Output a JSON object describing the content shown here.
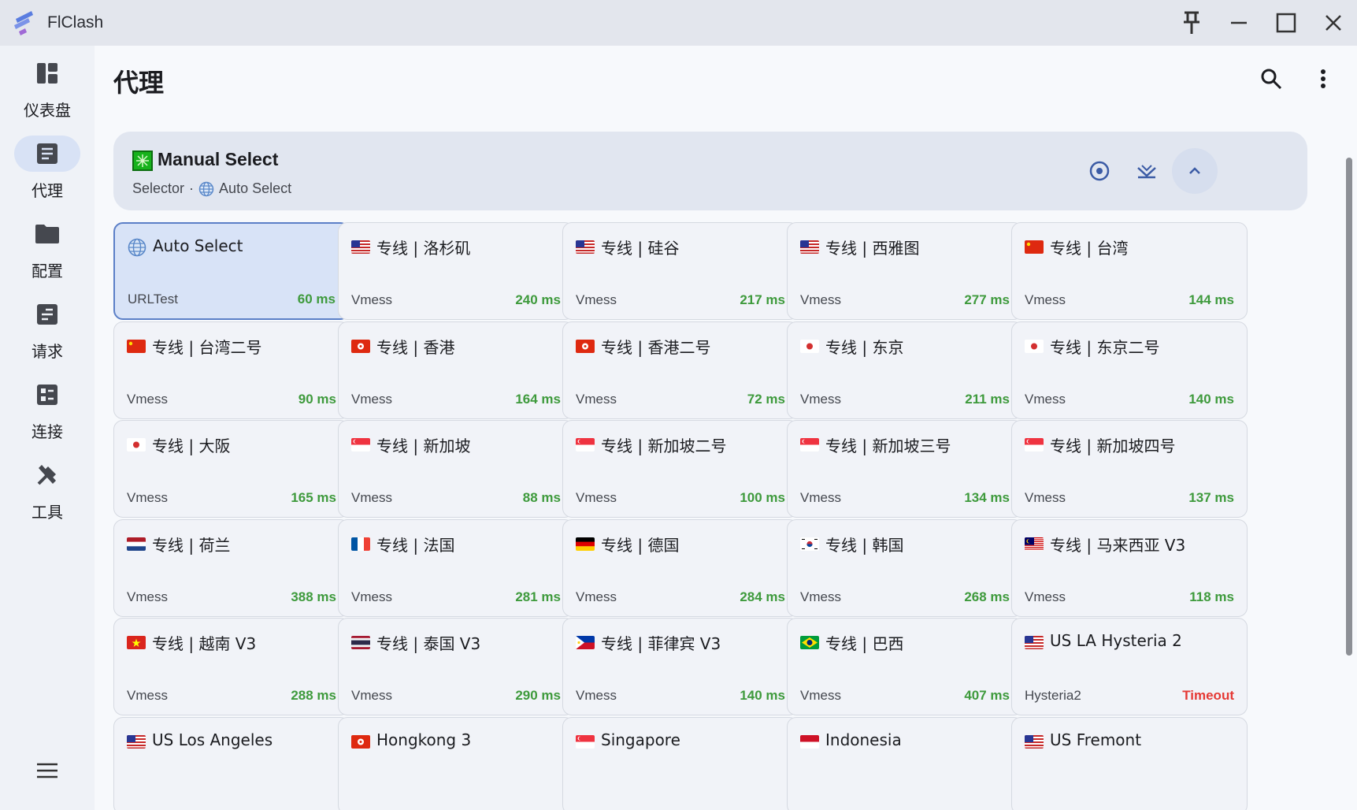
{
  "app": {
    "title": "FlClash"
  },
  "nav": {
    "items": [
      {
        "label": "仪表盘",
        "icon": "dashboard-icon",
        "active": false
      },
      {
        "label": "代理",
        "icon": "proxy-icon",
        "active": true
      },
      {
        "label": "配置",
        "icon": "folder-icon",
        "active": false
      },
      {
        "label": "请求",
        "icon": "requests-icon",
        "active": false
      },
      {
        "label": "连接",
        "icon": "connections-icon",
        "active": false
      },
      {
        "label": "工具",
        "icon": "tools-icon",
        "active": false
      }
    ]
  },
  "page": {
    "title": "代理"
  },
  "group": {
    "name": "Manual Select",
    "type": "Selector",
    "separator": "·",
    "current": "Auto Select"
  },
  "proxies": [
    {
      "name": "Auto Select",
      "type": "URLTest",
      "delay": "60 ms",
      "flag": "globe",
      "selected": true
    },
    {
      "name": "专线 | 洛杉矶",
      "type": "Vmess",
      "delay": "240 ms",
      "flag": "us"
    },
    {
      "name": "专线 | 硅谷",
      "type": "Vmess",
      "delay": "217 ms",
      "flag": "us"
    },
    {
      "name": "专线 | 西雅图",
      "type": "Vmess",
      "delay": "277 ms",
      "flag": "us"
    },
    {
      "name": "专线 | 台湾",
      "type": "Vmess",
      "delay": "144 ms",
      "flag": "cn"
    },
    {
      "name": "专线 | 台湾二号",
      "type": "Vmess",
      "delay": "90 ms",
      "flag": "cn"
    },
    {
      "name": "专线 | 香港",
      "type": "Vmess",
      "delay": "164 ms",
      "flag": "hk"
    },
    {
      "name": "专线 | 香港二号",
      "type": "Vmess",
      "delay": "72 ms",
      "flag": "hk"
    },
    {
      "name": "专线 | 东京",
      "type": "Vmess",
      "delay": "211 ms",
      "flag": "jp"
    },
    {
      "name": "专线 | 东京二号",
      "type": "Vmess",
      "delay": "140 ms",
      "flag": "jp"
    },
    {
      "name": "专线 | 大阪",
      "type": "Vmess",
      "delay": "165 ms",
      "flag": "jp"
    },
    {
      "name": "专线 | 新加坡",
      "type": "Vmess",
      "delay": "88 ms",
      "flag": "sg"
    },
    {
      "name": "专线 | 新加坡二号",
      "type": "Vmess",
      "delay": "100 ms",
      "flag": "sg"
    },
    {
      "name": "专线 | 新加坡三号",
      "type": "Vmess",
      "delay": "134 ms",
      "flag": "sg"
    },
    {
      "name": "专线 | 新加坡四号",
      "type": "Vmess",
      "delay": "137 ms",
      "flag": "sg"
    },
    {
      "name": "专线 | 荷兰",
      "type": "Vmess",
      "delay": "388 ms",
      "flag": "nl"
    },
    {
      "name": "专线 | 法国",
      "type": "Vmess",
      "delay": "281 ms",
      "flag": "fr"
    },
    {
      "name": "专线 | 德国",
      "type": "Vmess",
      "delay": "284 ms",
      "flag": "de"
    },
    {
      "name": "专线 | 韩国",
      "type": "Vmess",
      "delay": "268 ms",
      "flag": "kr"
    },
    {
      "name": "专线 | 马来西亚 V3",
      "type": "Vmess",
      "delay": "118 ms",
      "flag": "my"
    },
    {
      "name": "专线 | 越南 V3",
      "type": "Vmess",
      "delay": "288 ms",
      "flag": "vn"
    },
    {
      "name": "专线 | 泰国 V3",
      "type": "Vmess",
      "delay": "290 ms",
      "flag": "th"
    },
    {
      "name": "专线 | 菲律宾 V3",
      "type": "Vmess",
      "delay": "140 ms",
      "flag": "ph"
    },
    {
      "name": "专线 | 巴西",
      "type": "Vmess",
      "delay": "407 ms",
      "flag": "br"
    },
    {
      "name": "US LA Hysteria 2",
      "type": "Hysteria2",
      "delay": "Timeout",
      "flag": "us",
      "timeout": true
    },
    {
      "name": "US Los Angeles",
      "type": "",
      "delay": "",
      "flag": "us"
    },
    {
      "name": "Hongkong 3",
      "type": "",
      "delay": "",
      "flag": "hk"
    },
    {
      "name": "Singapore",
      "type": "",
      "delay": "",
      "flag": "sg"
    },
    {
      "name": "Indonesia",
      "type": "",
      "delay": "",
      "flag": "id"
    },
    {
      "name": "US Fremont",
      "type": "",
      "delay": "",
      "flag": "us"
    }
  ],
  "colors": {
    "accent": "#5b7fc7",
    "delay_ok": "#3e9a3c",
    "delay_timeout": "#e53935",
    "selected_bg": "#d8e3f7"
  }
}
